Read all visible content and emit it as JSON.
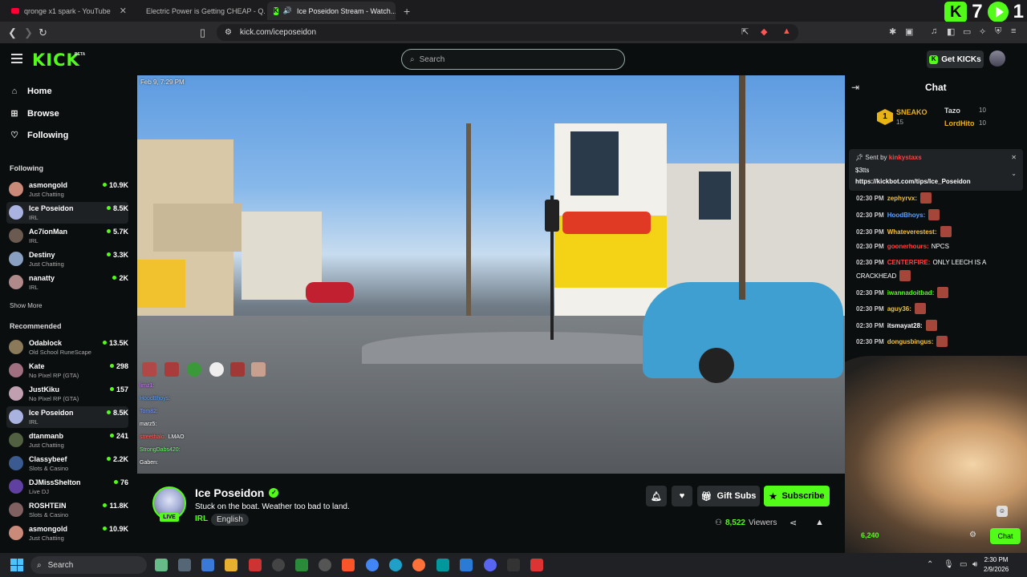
{
  "browser": {
    "tabs": [
      {
        "title": "qronge x1 spark - YouTube",
        "icon": "youtube-icon"
      },
      {
        "title": "Electric Power is Getting CHEAP - Q...",
        "icon": "youtube-icon"
      },
      {
        "title": "Ice Poseidon Stream - Watch...",
        "icon": "kick-icon"
      }
    ],
    "url": "kick.com/iceposeidon",
    "overlay": {
      "kick_count": "7",
      "rumble_count": "1"
    }
  },
  "header": {
    "logo": "KICK",
    "logo_badge": "BETA",
    "search_placeholder": "Search",
    "get_kicks": "Get KICKs"
  },
  "sidebar": {
    "nav": [
      {
        "label": "Home",
        "icon": "home-icon"
      },
      {
        "label": "Browse",
        "icon": "browse-icon"
      },
      {
        "label": "Following",
        "icon": "heart-icon"
      }
    ],
    "following_title": "Following",
    "following": [
      {
        "name": "asmongold",
        "category": "Just Chatting",
        "viewers": "10.9K",
        "color": "#c98a7a"
      },
      {
        "name": "Ice Poseidon",
        "category": "IRL",
        "viewers": "8.5K",
        "color": "#aab3e0",
        "selected": true
      },
      {
        "name": "Ac7ionMan",
        "category": "IRL",
        "viewers": "5.7K",
        "color": "#6a5a50"
      },
      {
        "name": "Destiny",
        "category": "Just Chatting",
        "viewers": "3.3K",
        "color": "#8aa0c0"
      },
      {
        "name": "nanatty",
        "category": "IRL",
        "viewers": "2K",
        "color": "#b08a8a"
      }
    ],
    "show_more": "Show More",
    "recommended_title": "Recommended",
    "recommended": [
      {
        "name": "Odablock",
        "category": "Old School RuneScape",
        "viewers": "13.5K",
        "color": "#8a7a5a"
      },
      {
        "name": "Kate",
        "category": "No Pixel RP (GTA)",
        "viewers": "298",
        "color": "#a07080"
      },
      {
        "name": "JustKiku",
        "category": "No Pixel RP (GTA)",
        "viewers": "157",
        "color": "#c0a0b0"
      },
      {
        "name": "Ice Poseidon",
        "category": "IRL",
        "viewers": "8.5K",
        "color": "#aab3e0",
        "selected": true
      },
      {
        "name": "dtanmanb",
        "category": "Just Chatting",
        "viewers": "241",
        "color": "#506040"
      },
      {
        "name": "Classybeef",
        "category": "Slots & Casino",
        "viewers": "2.2K",
        "color": "#3a5a90"
      },
      {
        "name": "DJMissShelton",
        "category": "Live DJ",
        "viewers": "76",
        "color": "#6040a0"
      },
      {
        "name": "ROSHTEIN",
        "category": "Slots & Casino",
        "viewers": "11.8K",
        "color": "#806060"
      },
      {
        "name": "asmongold",
        "category": "Just Chatting",
        "viewers": "10.9K",
        "color": "#c98a7a"
      }
    ]
  },
  "video": {
    "timestamp": "Feb 9, 7:29 PM",
    "overlay_chat": [
      {
        "user": "limz1:",
        "color": "#d070ff"
      },
      {
        "user": "HoodBhoys:",
        "color": "#5aa0ff"
      },
      {
        "user": "Tom82:",
        "color": "#7aa0ff"
      },
      {
        "user": "marz5:",
        "color": "#ffffff"
      },
      {
        "user": "streethalo:",
        "text": "LMAO",
        "color": "#ff6060"
      },
      {
        "user": "StrongDabs420:",
        "color": "#70ff70"
      },
      {
        "user": "Gaben:",
        "color": "#ffffff"
      }
    ]
  },
  "stream": {
    "streamer": "Ice Poseidon",
    "live": "LIVE",
    "title": "Stuck on the boat. Weather too bad to land.",
    "category": "IRL",
    "language": "English",
    "gift_subs": "Gift Subs",
    "subscribe": "Subscribe",
    "viewers": "8,522",
    "viewers_label": "Viewers"
  },
  "chat": {
    "title": "Chat",
    "leaderboard": [
      {
        "name": "SNEAKO",
        "value": "15",
        "color": "#e8b317"
      },
      {
        "name": "Tazo",
        "value": "10",
        "color": "#dddddd"
      },
      {
        "name": "LordHito",
        "value": "10",
        "color": "#e8b317"
      }
    ],
    "rank": "1",
    "pinned": {
      "sent_by": "Sent by",
      "sender": "kinkystaxs",
      "amount": "$3tts",
      "link": "https://kickbot.com/tips/Ice_Poseidon"
    },
    "messages": [
      {
        "time": "02:30 PM",
        "user": "zephyrvx:",
        "text": "",
        "color": "#f0c040",
        "emote": true
      },
      {
        "time": "02:30 PM",
        "user": "HoodBhoys:",
        "text": "",
        "color": "#5aa0ff",
        "emote": true
      },
      {
        "time": "02:30 PM",
        "user": "Whateverestest:",
        "text": "",
        "color": "#f0c040",
        "emote": true
      },
      {
        "time": "02:30 PM",
        "user": "goonerhours:",
        "text": "NPCS",
        "color": "#ff4040",
        "emote": false
      },
      {
        "time": "02:30 PM",
        "user": "CENTERFIRE:",
        "text": "ONLY LEECH IS A",
        "color": "#ff4040",
        "emote": false
      },
      {
        "time": "",
        "user": "",
        "text": "CRACKHEAD",
        "color": "#ffffff",
        "emote": true
      },
      {
        "time": "02:30 PM",
        "user": "iwannadoitbad:",
        "text": "",
        "color": "#53fc18",
        "emote": true
      },
      {
        "time": "02:30 PM",
        "user": "aguy36:",
        "text": "",
        "color": "#f0c040",
        "emote": true
      },
      {
        "time": "02:30 PM",
        "user": "itsmayat28:",
        "text": "",
        "color": "#ffffff",
        "emote": true
      },
      {
        "time": "02:30 PM",
        "user": "dongusbingus:",
        "text": "",
        "color": "#f0c040",
        "emote": true
      }
    ],
    "count": "6,240",
    "chat_button": "Chat"
  },
  "taskbar": {
    "search": "Search",
    "time": "2:30 PM",
    "date": "2/9/2026"
  },
  "colors": {
    "accent": "#53fc18",
    "background": "#0b0e0f"
  }
}
